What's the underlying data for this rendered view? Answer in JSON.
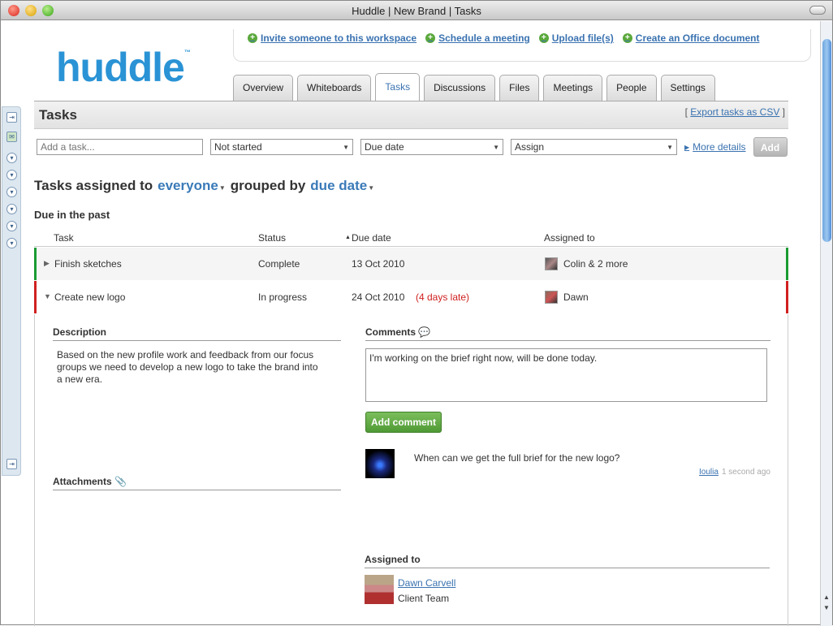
{
  "window": {
    "title": "Huddle | New Brand | Tasks"
  },
  "toplinks": [
    {
      "label": "Invite someone to this workspace"
    },
    {
      "label": "Schedule a meeting"
    },
    {
      "label": "Upload file(s)"
    },
    {
      "label": "Create an Office document"
    }
  ],
  "logo": {
    "text": "huddle",
    "tm": "™"
  },
  "tabs": [
    {
      "label": "Overview",
      "active": false
    },
    {
      "label": "Whiteboards",
      "active": false
    },
    {
      "label": "Tasks",
      "active": true
    },
    {
      "label": "Discussions",
      "active": false
    },
    {
      "label": "Files",
      "active": false
    },
    {
      "label": "Meetings",
      "active": false
    },
    {
      "label": "People",
      "active": false
    },
    {
      "label": "Settings",
      "active": false
    }
  ],
  "page": {
    "title": "Tasks",
    "export_prefix": "[ ",
    "export_label": "Export tasks as CSV",
    "export_suffix": " ]"
  },
  "add_task": {
    "placeholder": "Add a task...",
    "status": "Not started",
    "due": "Due date",
    "assign": "Assign",
    "more_details": "More details",
    "add": "Add"
  },
  "filter": {
    "prefix": "Tasks assigned to",
    "who": "everyone",
    "middle": "grouped by",
    "group": "due date"
  },
  "section_title": "Due in the past",
  "columns": {
    "task": "Task",
    "status": "Status",
    "due": "Due date",
    "assigned": "Assigned to"
  },
  "rows": [
    {
      "toggle": "▶",
      "task": "Finish sketches",
      "status": "Complete",
      "due": "13 Oct 2010",
      "late": "",
      "assigned": "Colin & 2 more",
      "status_color": "#1a9b32"
    },
    {
      "toggle": "▼",
      "task": "Create new logo",
      "status": "In progress",
      "due": "24 Oct 2010",
      "late": "(4 days late)",
      "assigned": "Dawn",
      "status_color": "#d02020"
    }
  ],
  "detail": {
    "description_label": "Description",
    "description": "Based on the new profile work and feedback from our focus groups we need to develop a new logo to take the brand into a new era.",
    "comments_label": "Comments",
    "comment_draft": "I'm working on the brief right now, will be done today.",
    "add_comment": "Add comment",
    "comment": {
      "text": "When can we get the full brief for the new logo?",
      "author": "Ioulia",
      "time": "1 second ago"
    },
    "attachments_label": "Attachments",
    "assigned_label": "Assigned to",
    "assignee": {
      "name": "Dawn Carvell",
      "team": "Client Team"
    }
  }
}
